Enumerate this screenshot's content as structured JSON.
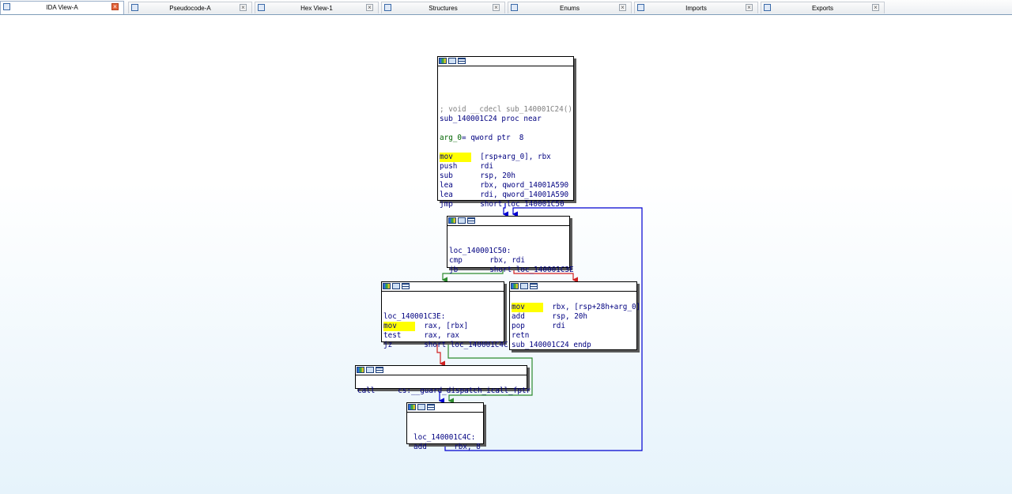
{
  "tabs": [
    {
      "label": "IDA View-A",
      "active": true
    },
    {
      "label": "Pseudocode-A",
      "active": false
    },
    {
      "label": "Hex View-1",
      "active": false
    },
    {
      "label": "Structures",
      "active": false
    },
    {
      "label": "Enums",
      "active": false
    },
    {
      "label": "Imports",
      "active": false
    },
    {
      "label": "Exports",
      "active": false
    }
  ],
  "colors": {
    "edge_blue": "#0000d0",
    "edge_green": "#2e8b2e",
    "edge_red": "#d02020",
    "highlight": "#ffff00"
  },
  "nodes": {
    "n1": {
      "comment": "; void __cdecl sub_140001C24()",
      "proc": "sub_140001C24 proc near",
      "arg_name": "arg_0",
      "arg_def": "= qword ptr  8",
      "lines": [
        {
          "mn": "mov",
          "op": "[rsp+arg_0], rbx"
        },
        {
          "mn": "push",
          "op": "rdi"
        },
        {
          "mn": "sub",
          "op": "rsp, 20h"
        },
        {
          "mn": "lea",
          "op": "rbx, qword_14001A590"
        },
        {
          "mn": "lea",
          "op": "rdi, qword_14001A590"
        },
        {
          "mn": "jmp",
          "op": "short loc_140001C50"
        }
      ]
    },
    "n2": {
      "label": "loc_140001C50:",
      "lines": [
        {
          "mn": "cmp",
          "op": "rbx, rdi"
        },
        {
          "mn": "jb",
          "op": "short loc_140001C3E"
        }
      ]
    },
    "n3": {
      "label": "loc_140001C3E:",
      "lines": [
        {
          "mn": "mov",
          "op": "rax, [rbx]"
        },
        {
          "mn": "test",
          "op": "rax, rax"
        },
        {
          "mn": "jz",
          "op": "short loc_140001C4C"
        }
      ]
    },
    "n4": {
      "lines": [
        {
          "mn": "mov",
          "op": "rbx, [rsp+28h+arg_0]"
        },
        {
          "mn": "add",
          "op": "rsp, 20h"
        },
        {
          "mn": "pop",
          "op": "rdi"
        },
        {
          "mn": "retn",
          "op": ""
        }
      ],
      "endp": "sub_140001C24 endp"
    },
    "n5": {
      "lines": [
        {
          "mn": "call",
          "op": "cs:__guard_dispatch_icall_fptr"
        }
      ]
    },
    "n6": {
      "label": "loc_140001C4C:",
      "lines": [
        {
          "mn": "add",
          "op": "rbx, 8"
        }
      ]
    }
  }
}
